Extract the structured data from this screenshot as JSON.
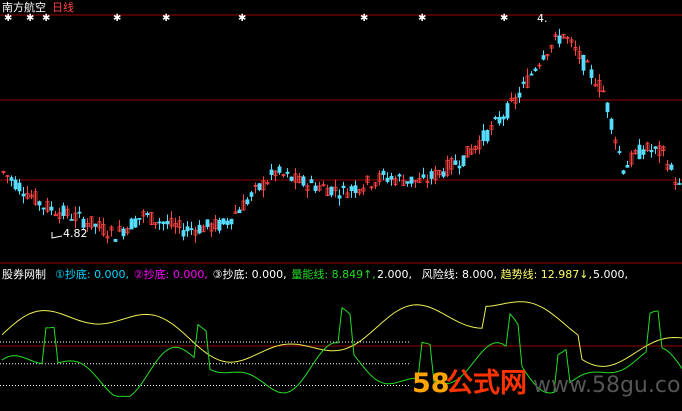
{
  "header": {
    "stock_name": "南方航空",
    "period": "日线"
  },
  "main_panel": {
    "low_label": "4.82",
    "high_label": "4.",
    "signal_marks": [
      "✱",
      "✱",
      "✱",
      "✱",
      "✱",
      "✱",
      "✱",
      "✱",
      "✱"
    ]
  },
  "indicator_panel": {
    "name": "股券网制",
    "items": [
      {
        "label": "①抄底:",
        "value": "0.000",
        "color": "#00d7ff"
      },
      {
        "label": "②抄底:",
        "value": "0.000",
        "color": "#ff00ff"
      },
      {
        "label": "③抄底:",
        "value": "0.000",
        "color": "#ffffff"
      },
      {
        "label": "量能线:",
        "value": "8.849",
        "arrow": "↑",
        "color": "#22dd22"
      },
      {
        "label": "",
        "value": "2.000",
        "color": "#ffffff"
      },
      {
        "label": "风险线:",
        "value": "8.000",
        "color": "#ffffff"
      },
      {
        "label": "趋势线:",
        "value": "12.987",
        "arrow": "↓",
        "color": "#ffff66"
      },
      {
        "label": "",
        "value": "5.000",
        "color": "#ffffff"
      }
    ]
  },
  "watermark": {
    "digits": "58",
    "brand": "公式网",
    "url": "www.58gu.com"
  },
  "chart_data": {
    "type": "candlestick",
    "n_candles": 170,
    "price_range": [
      4.6,
      7.2
    ],
    "low_price": 4.82,
    "colors": {
      "up": "#ff4444",
      "down": "#55ddff",
      "grid": "#990000",
      "energy_line": "#22dd22",
      "trend_line": "#eeee55",
      "label_white": "#ffffff"
    },
    "indicator_levels": [
      2.0,
      5.0,
      8.0
    ]
  }
}
